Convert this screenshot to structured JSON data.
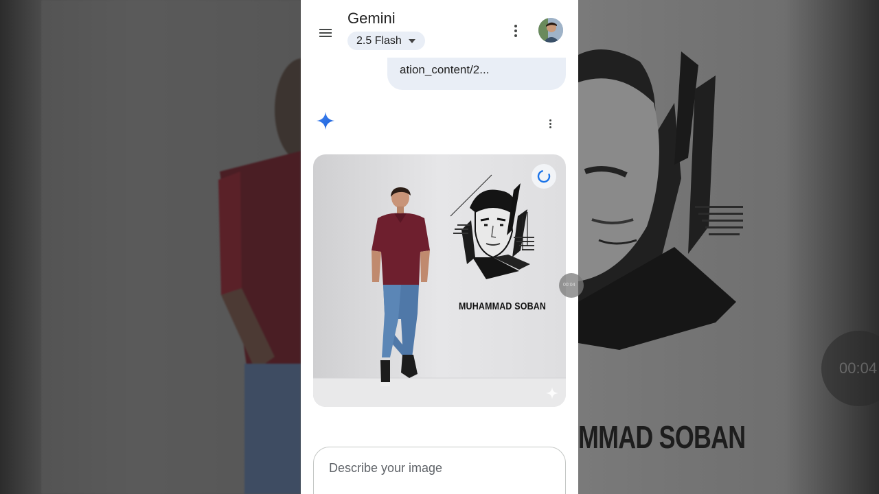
{
  "app": {
    "title": "Gemini",
    "model_label": "2.5 Flash"
  },
  "icons": {
    "menu": "menu-icon",
    "more": "more-vert-icon",
    "gemini": "gemini-sparkle-icon",
    "loading": "loading-spinner-icon",
    "watermark": "sparkle-watermark-icon"
  },
  "conversation": {
    "user_message_tail": "ation_content/2...",
    "response": {
      "image_caption_text": "MUHAMMAD SOBAN"
    }
  },
  "composer": {
    "placeholder": "Describe your image"
  },
  "background": {
    "overlay_text": "MMAD SOBAN",
    "timer_text": "00:04",
    "small_timer_text": "00:04"
  },
  "colors": {
    "accent_blue": "#1a73e8",
    "chip_bg": "#e9eef6",
    "shirt": "#6e1f2e",
    "jeans": "#4f78a8"
  }
}
